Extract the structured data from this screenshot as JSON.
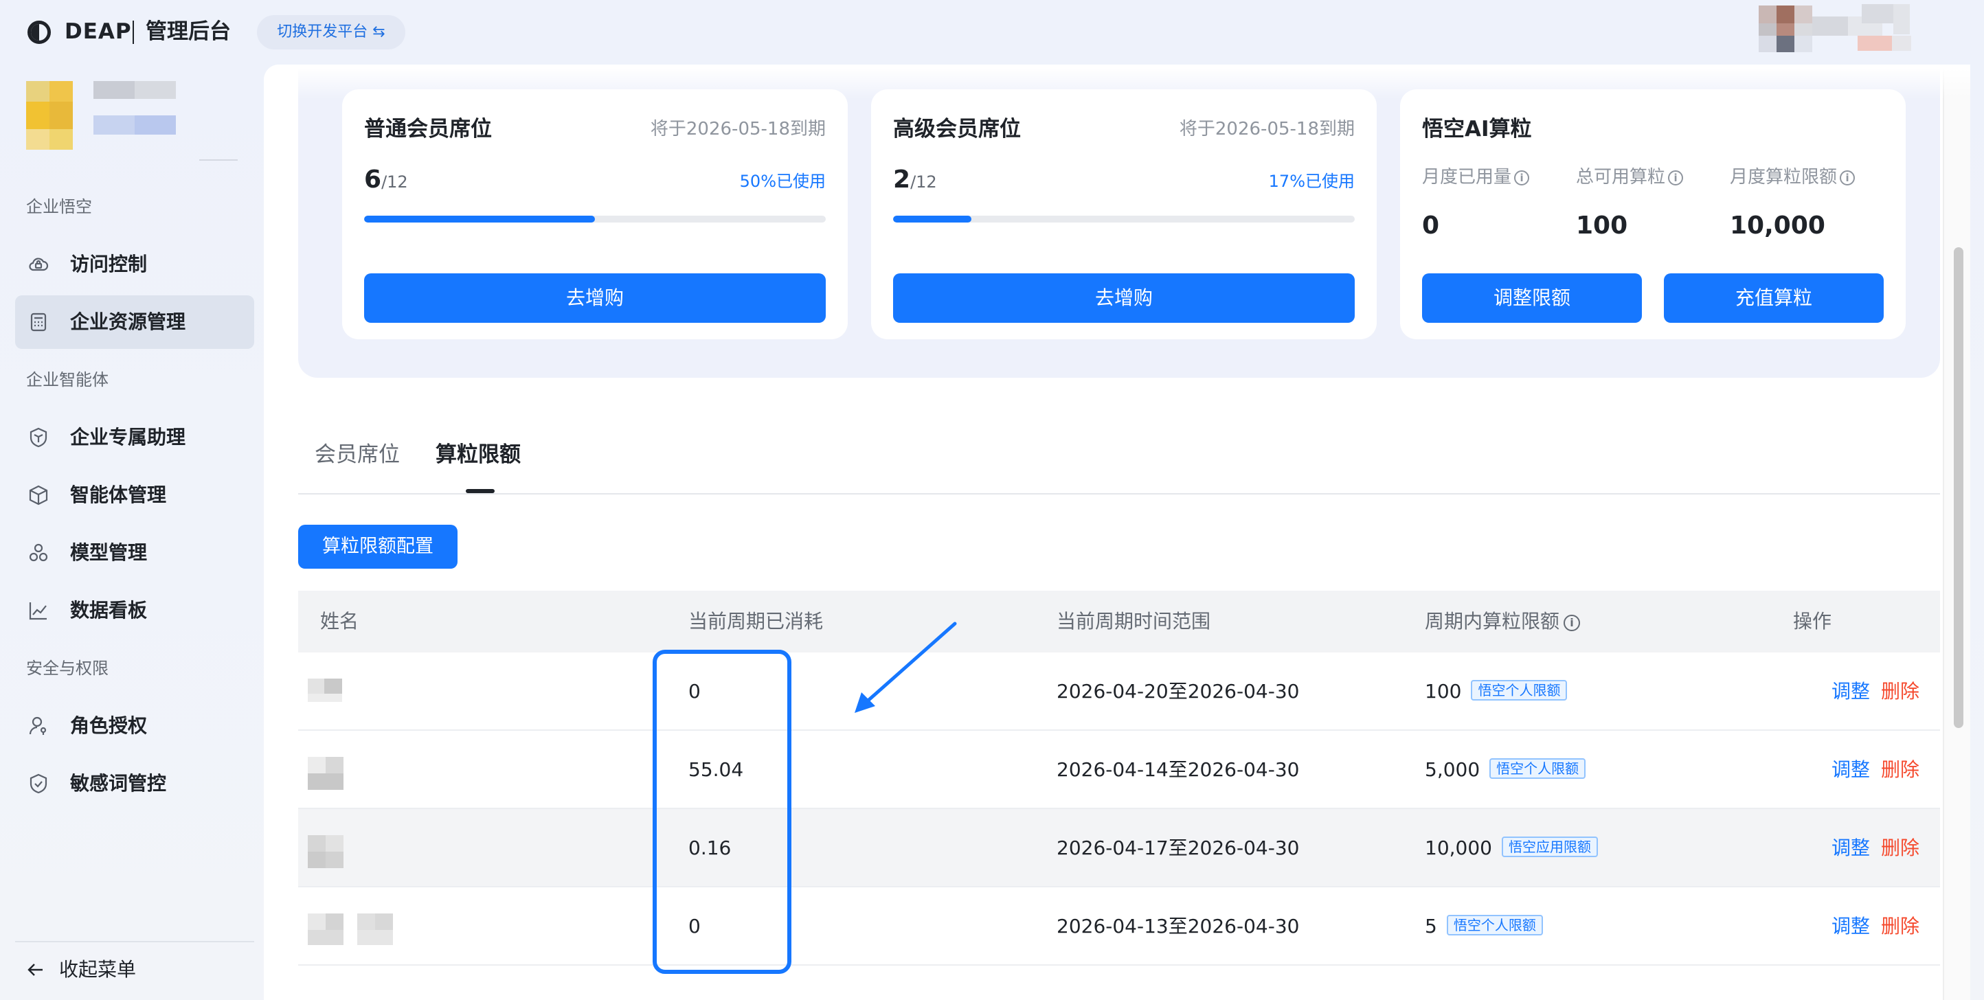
{
  "app": {
    "brand": "DEAP",
    "subtitle": "管理后台",
    "switch_label": "切换开发平台 ⇆"
  },
  "sidebar": {
    "groups": [
      {
        "title": "企业悟空"
      },
      {
        "title": "企业智能体"
      },
      {
        "title": "安全与权限"
      }
    ],
    "items": [
      {
        "label": "访问控制",
        "icon": "cloud-lock-icon"
      },
      {
        "label": "企业资源管理",
        "icon": "calculator-icon",
        "active": true
      },
      {
        "label": "企业专属助理",
        "icon": "cube-shield-icon"
      },
      {
        "label": "智能体管理",
        "icon": "cube-icon"
      },
      {
        "label": "模型管理",
        "icon": "circles-icon"
      },
      {
        "label": "数据看板",
        "icon": "line-chart-icon"
      },
      {
        "label": "角色授权",
        "icon": "user-key-icon"
      },
      {
        "label": "敏感词管控",
        "icon": "shield-check-icon"
      }
    ],
    "collapse_label": "收起菜单"
  },
  "cards": {
    "normal": {
      "title": "普通会员席位",
      "expire": "将于2026-05-18到期",
      "used": "6",
      "total": "/12",
      "used_pct_label": "50%已使用",
      "progress": 0.5,
      "button": "去增购"
    },
    "premium": {
      "title": "高级会员席位",
      "expire": "将于2026-05-18到期",
      "used": "2",
      "total": "/12",
      "used_pct_label": "17%已使用",
      "progress": 0.17,
      "button": "去增购"
    },
    "ai": {
      "title": "悟空AI算粒",
      "stats": [
        {
          "label": "月度已用量",
          "value": "0"
        },
        {
          "label": "总可用算粒",
          "value": "100"
        },
        {
          "label": "月度算粒限额",
          "value": "10,000"
        }
      ],
      "adjust_button": "调整限额",
      "recharge_button": "充值算粒"
    }
  },
  "tabs": {
    "seats": "会员席位",
    "quota": "算粒限额",
    "active": "quota"
  },
  "config_button": "算粒限额配置",
  "table": {
    "headers": {
      "name": "姓名",
      "consumed": "当前周期已消耗",
      "range": "当前周期时间范围",
      "limit": "周期内算粒限额",
      "actions": "操作"
    },
    "info_glyph": "i",
    "rows": [
      {
        "consumed": "0",
        "range": "2026-04-20至2026-04-30",
        "limit": "100",
        "tag": "悟空个人限额",
        "adjust": "调整",
        "delete": "删除"
      },
      {
        "consumed": "55.04",
        "range": "2026-04-14至2026-04-30",
        "limit": "5,000",
        "tag": "悟空个人限额",
        "adjust": "调整",
        "delete": "删除"
      },
      {
        "consumed": "0.16",
        "range": "2026-04-17至2026-04-30",
        "limit": "10,000",
        "tag": "悟空应用限额",
        "adjust": "调整",
        "delete": "删除"
      },
      {
        "consumed": "0",
        "range": "2026-04-13至2026-04-30",
        "limit": "5",
        "tag": "悟空个人限额",
        "adjust": "调整",
        "delete": "删除"
      }
    ]
  },
  "colors": {
    "primary": "#1677ff",
    "danger": "#f54a2e",
    "sidebar_active": "#dde3ee"
  }
}
